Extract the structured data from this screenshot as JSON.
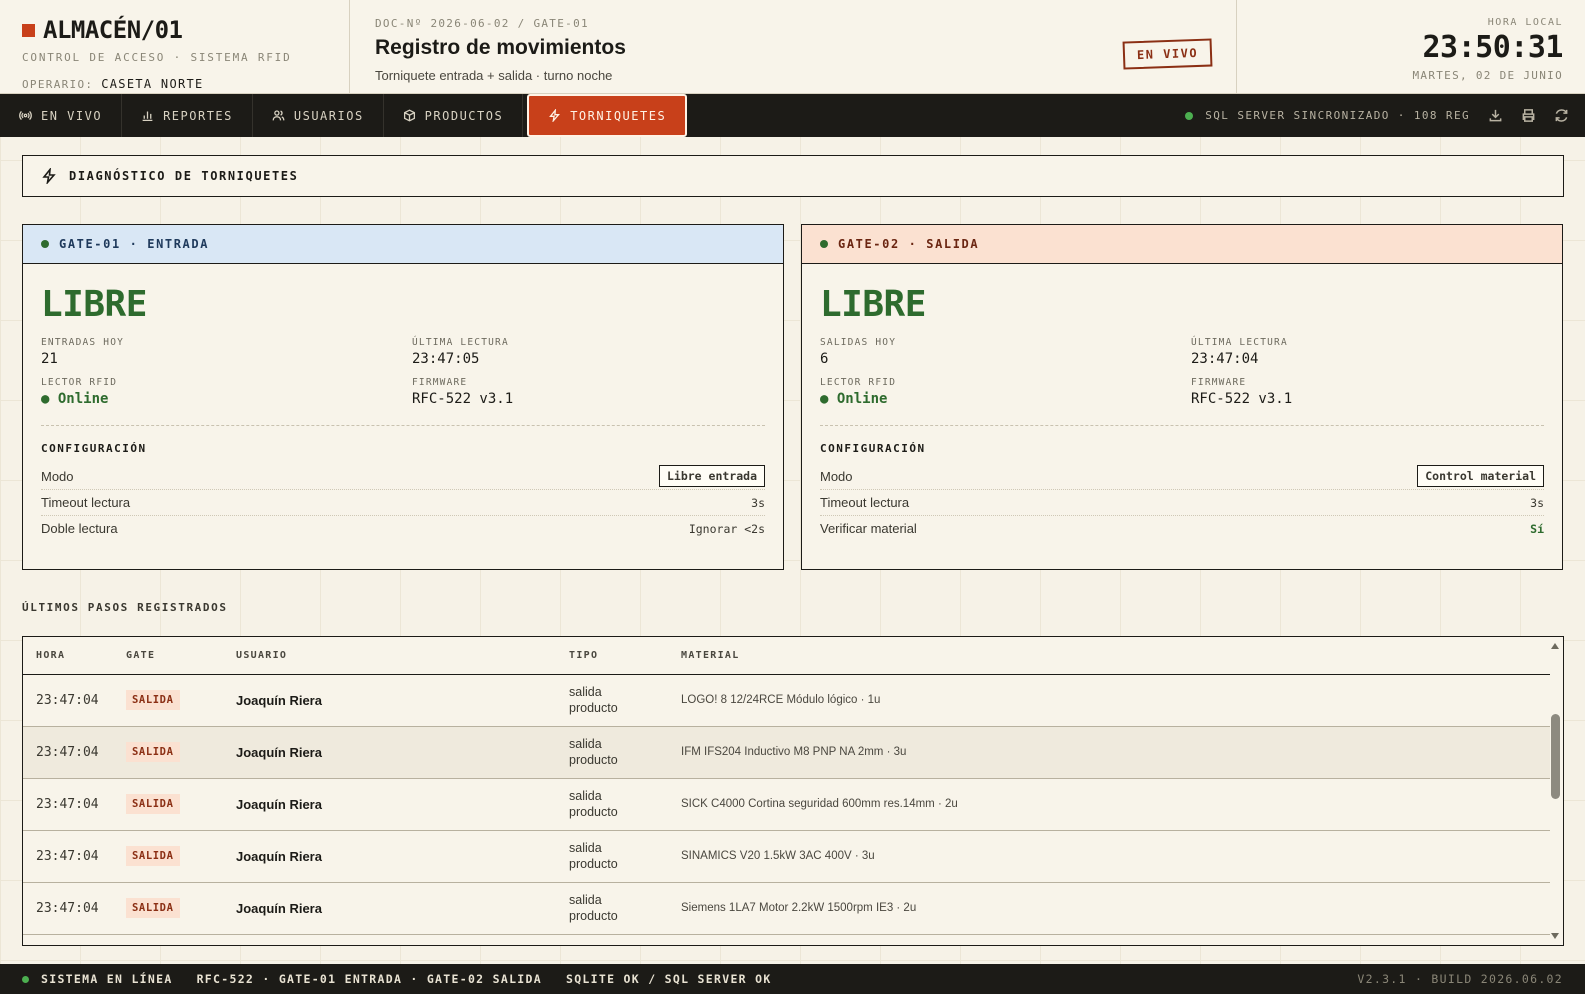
{
  "header": {
    "brand_title": "ALMACÉN/01",
    "brand_subtitle": "CONTROL DE ACCESO · SISTEMA RFID",
    "operator_label": "OPERARIO:",
    "operator_value": "CASETA NORTE",
    "doc_number": "DOC-Nº 2026-06-02 / GATE-01",
    "doc_title": "Registro de movimientos",
    "doc_subtitle": "Torniquete entrada + salida · turno noche",
    "live_stamp": "EN VIVO",
    "clock_label": "HORA LOCAL",
    "clock_time": "23:50:31",
    "clock_date": "MARTES, 02 DE JUNIO"
  },
  "nav": {
    "tabs": [
      {
        "label": "EN VIVO",
        "icon": "broadcast-icon"
      },
      {
        "label": "REPORTES",
        "icon": "bar-chart-icon"
      },
      {
        "label": "USUARIOS",
        "icon": "users-icon"
      },
      {
        "label": "PRODUCTOS",
        "icon": "package-icon"
      },
      {
        "label": "TORNIQUETES",
        "icon": "lightning-icon",
        "active": true
      }
    ],
    "sync_status": "SQL SERVER SINCRONIZADO · 108 REG"
  },
  "diagnostic": {
    "title": "DIAGNÓSTICO DE TORNIQUETES"
  },
  "gates": [
    {
      "title": "GATE-01 · ENTRADA",
      "status": "LIBRE",
      "count_label": "ENTRADAS HOY",
      "count_value": "21",
      "last_read_label": "ÚLTIMA LECTURA",
      "last_read_value": "23:47:05",
      "reader_label": "LECTOR RFID",
      "reader_value": "● Online",
      "firmware_label": "FIRMWARE",
      "firmware_value": "RFC-522 v3.1",
      "config_title": "CONFIGURACIÓN",
      "config": [
        {
          "key": "Modo",
          "value": "Libre entrada"
        },
        {
          "key": "Timeout lectura",
          "value": "3s"
        },
        {
          "key": "Doble lectura",
          "value": "Ignorar <2s"
        }
      ]
    },
    {
      "title": "GATE-02 · SALIDA",
      "status": "LIBRE",
      "count_label": "SALIDAS HOY",
      "count_value": "6",
      "last_read_label": "ÚLTIMA LECTURA",
      "last_read_value": "23:47:04",
      "reader_label": "LECTOR RFID",
      "reader_value": "● Online",
      "firmware_label": "FIRMWARE",
      "firmware_value": "RFC-522 v3.1",
      "config_title": "CONFIGURACIÓN",
      "config": [
        {
          "key": "Modo",
          "value": "Control material"
        },
        {
          "key": "Timeout lectura",
          "value": "3s"
        },
        {
          "key": "Verificar material",
          "value": "Sí"
        }
      ]
    }
  ],
  "passes": {
    "title": "ÚLTIMOS PASOS REGISTRADOS",
    "columns": [
      "HORA",
      "GATE",
      "USUARIO",
      "TIPO",
      "MATERIAL"
    ],
    "rows": [
      {
        "time": "23:47:04",
        "gate": "SALIDA",
        "user": "Joaquín Riera",
        "tipo_1": "salida",
        "tipo_2": "producto",
        "material": "LOGO! 8 12/24RCE Módulo lógico · 1u"
      },
      {
        "time": "23:47:04",
        "gate": "SALIDA",
        "user": "Joaquín Riera",
        "tipo_1": "salida",
        "tipo_2": "producto",
        "material": "IFM IFS204 Inductivo M8 PNP NA 2mm · 3u"
      },
      {
        "time": "23:47:04",
        "gate": "SALIDA",
        "user": "Joaquín Riera",
        "tipo_1": "salida",
        "tipo_2": "producto",
        "material": "SICK C4000 Cortina seguridad 600mm res.14mm · 2u"
      },
      {
        "time": "23:47:04",
        "gate": "SALIDA",
        "user": "Joaquín Riera",
        "tipo_1": "salida",
        "tipo_2": "producto",
        "material": "SINAMICS V20 1.5kW 3AC 400V · 3u"
      },
      {
        "time": "23:47:04",
        "gate": "SALIDA",
        "user": "Joaquín Riera",
        "tipo_1": "salida",
        "tipo_2": "producto",
        "material": "Siemens 1LA7 Motor 2.2kW 1500rpm IE3 · 2u"
      }
    ]
  },
  "footer": {
    "system_status": "SISTEMA EN LÍNEA",
    "hardware": "RFC-522 · GATE-01 ENTRADA · GATE-02 SALIDA",
    "db_status": "SQLITE OK / SQL SERVER OK",
    "version": "V2.3.1 · BUILD 2026.06.02"
  },
  "colors": {
    "accent": "#c8401a",
    "dark": "#1c1b17",
    "paper": "#f6f2e7",
    "online_green": "#2e6b2e",
    "gate_entry_bg": "#d9e7f5",
    "gate_exit_bg": "#fbe1d1"
  }
}
